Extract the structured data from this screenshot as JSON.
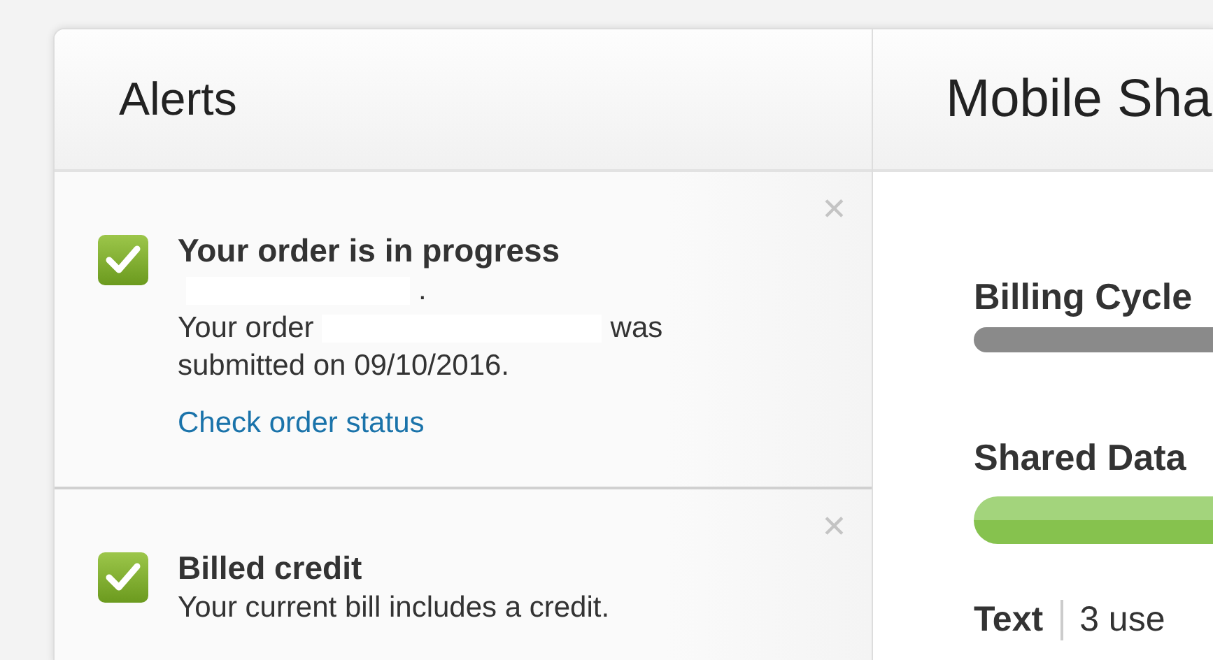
{
  "alerts_panel": {
    "title": "Alerts",
    "alerts": [
      {
        "close": "✕",
        "title": "Your order is in progress",
        "lines": [
          {
            "after": "."
          },
          {
            "before": "Your order",
            "after": "was"
          }
        ],
        "text": "submitted on 09/10/2016.",
        "link": "Check order status"
      },
      {
        "close": "✕",
        "title": "Billed credit",
        "text": "Your current bill includes a credit."
      }
    ]
  },
  "share_panel": {
    "title": "Mobile Sha",
    "meters": [
      {
        "label": "Billing Cycle",
        "kind": "thin"
      },
      {
        "label": "Shared Data",
        "kind": "thick"
      }
    ],
    "usage_row": {
      "label": "Text",
      "value": "3 use"
    }
  }
}
